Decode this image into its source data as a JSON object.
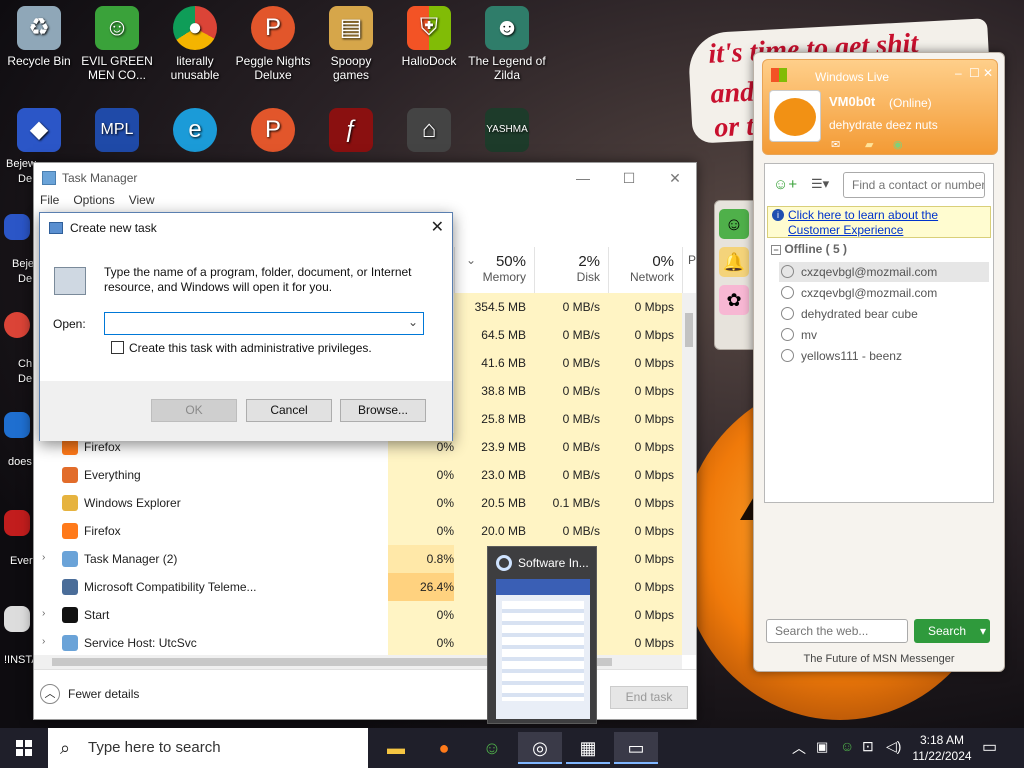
{
  "desktop": {
    "banner_lines": [
      "it's time to get shit",
      "and",
      "or t"
    ],
    "icons": [
      {
        "label": "Recycle Bin",
        "icon": "recycle-bin-icon"
      },
      {
        "label": "EVIL GREEN MEN CO...",
        "icon": "msn-buddies-icon"
      },
      {
        "label": "literally unusable",
        "icon": "chrome-icon"
      },
      {
        "label": "Peggle Nights Deluxe",
        "icon": "peggle-icon"
      },
      {
        "label": "Spoopy games",
        "icon": "folder-icon"
      },
      {
        "label": "HalloDock",
        "icon": "windows-shield-icon"
      },
      {
        "label": "The Legend of Zilda",
        "icon": "game-character-icon"
      }
    ],
    "second_row_icons": [
      "bejeweled-icon",
      "mpl-icon",
      "edge-icon",
      "peggle-icon",
      "flash-icon",
      "remote-desktop-icon",
      "yashma-icon"
    ],
    "edge_labels": [
      "Bejew",
      "De",
      "Beje",
      "De",
      "Ch",
      "De",
      "does",
      "Ever",
      "!INSTA"
    ]
  },
  "task_manager": {
    "title": "Task Manager",
    "menu": [
      "File",
      "Options",
      "View"
    ],
    "columns": [
      {
        "pct": "50%",
        "label": "Memory"
      },
      {
        "pct": "2%",
        "label": "Disk"
      },
      {
        "pct": "0%",
        "label": "Network"
      },
      {
        "pct": "",
        "label": "P"
      }
    ],
    "rows": [
      {
        "name": "",
        "cpu": "",
        "memory": "354.5 MB",
        "disk": "0 MB/s",
        "network": "0 Mbps",
        "expand": ""
      },
      {
        "name": "",
        "cpu": "",
        "memory": "64.5 MB",
        "disk": "0 MB/s",
        "network": "0 Mbps",
        "expand": ""
      },
      {
        "name": "",
        "cpu": "",
        "memory": "41.6 MB",
        "disk": "0 MB/s",
        "network": "0 Mbps",
        "expand": ""
      },
      {
        "name": "",
        "cpu": "",
        "memory": "38.8 MB",
        "disk": "0 MB/s",
        "network": "0 Mbps",
        "expand": ""
      },
      {
        "name": "",
        "cpu": "",
        "memory": "25.8 MB",
        "disk": "0 MB/s",
        "network": "0 Mbps",
        "expand": ""
      },
      {
        "name": "Firefox",
        "cpu": "0%",
        "memory": "23.9 MB",
        "disk": "0 MB/s",
        "network": "0 Mbps",
        "expand": ""
      },
      {
        "name": "Everything",
        "cpu": "0%",
        "memory": "23.0 MB",
        "disk": "0 MB/s",
        "network": "0 Mbps",
        "expand": ""
      },
      {
        "name": "Windows Explorer",
        "cpu": "0%",
        "memory": "20.5 MB",
        "disk": "0.1 MB/s",
        "network": "0 Mbps",
        "expand": ""
      },
      {
        "name": "Firefox",
        "cpu": "0%",
        "memory": "20.0 MB",
        "disk": "0 MB/s",
        "network": "0 Mbps",
        "expand": ""
      },
      {
        "name": "Task Manager (2)",
        "cpu": "0.8%",
        "memory": "",
        "disk": "",
        "network": "0 Mbps",
        "expand": "›"
      },
      {
        "name": "Microsoft Compatibility Teleme...",
        "cpu": "26.4%",
        "memory": "",
        "disk": "",
        "network": "0 Mbps",
        "expand": ""
      },
      {
        "name": "Start",
        "cpu": "0%",
        "memory": "",
        "disk": "",
        "network": "0 Mbps",
        "expand": "›"
      },
      {
        "name": "Service Host: UtcSvc",
        "cpu": "0%",
        "memory": "",
        "disk": "",
        "network": "0 Mbps",
        "expand": "›"
      }
    ],
    "fewer_details": "Fewer details",
    "end_task": "End task"
  },
  "dialog": {
    "title": "Create new task",
    "description": "Type the name of a program, folder, document, or Internet resource, and Windows will open it for you.",
    "open_label": "Open:",
    "open_value": "",
    "checkbox_label": "Create this task with administrative privileges.",
    "ok": "OK",
    "cancel": "Cancel",
    "browse": "Browse..."
  },
  "msn": {
    "window_title": "Windows Live",
    "username": "VM0b0t",
    "status": "(Online)",
    "personal_message": "dehydrate deez nuts",
    "search_placeholder": "Find a contact or number",
    "info_link": "Click here to learn about the Customer Experience",
    "group_header": "Offline ( 5 )",
    "contacts": [
      "cxzqevbgl@mozmail.com",
      "cxzqevbgl@mozmail.com",
      "dehydrated bear cube",
      "mv",
      "yellows111 - beenz"
    ],
    "web_search_placeholder": "Search the web...",
    "search_button": "Search",
    "footer": "The Future of MSN Messenger"
  },
  "taskbar": {
    "search_placeholder": "Type here to search",
    "time": "3:18 AM",
    "date": "11/22/2024",
    "thumbnail_title": "Software In..."
  },
  "colors": {
    "accent": "#0078d7",
    "msn_orange": "#f39a34",
    "search_green": "#2f9a3c"
  }
}
